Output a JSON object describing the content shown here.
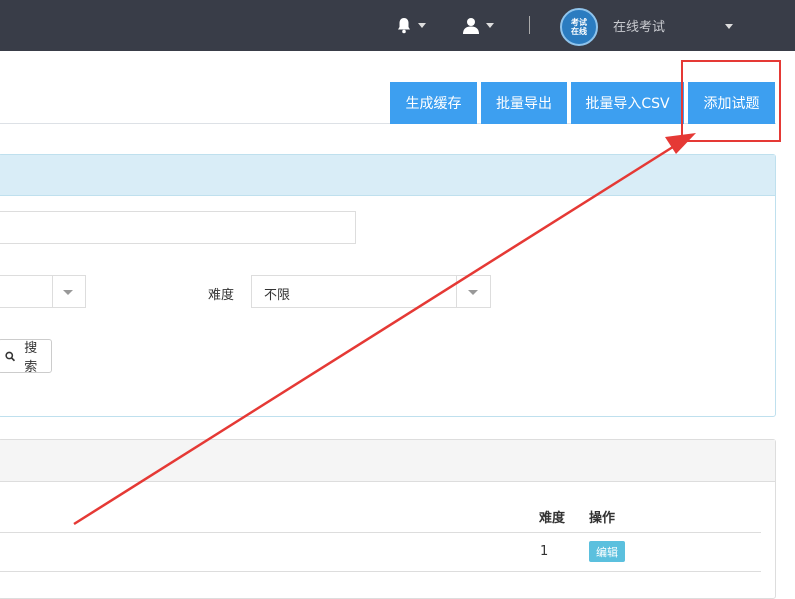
{
  "topbar": {
    "bell_icon": "bell-icon",
    "user_icon": "user-icon",
    "logo_lines": [
      "考试",
      "在线"
    ],
    "brand_name": "在线考试"
  },
  "toolbar": {
    "buttons": [
      "生成缓存",
      "批量导出",
      "批量导入CSV",
      "添加试题"
    ]
  },
  "filters": {
    "difficulty_label": "难度",
    "difficulty_value": "不限",
    "search_label": "搜索"
  },
  "table": {
    "headers": [
      "难度",
      "操作"
    ],
    "rows": [
      {
        "difficulty": "1",
        "action": "编辑"
      }
    ]
  },
  "colors": {
    "topbar": "#393d48",
    "primary": "#3d9ff0",
    "info": "#5bc0de",
    "annotation": "#e53935"
  }
}
